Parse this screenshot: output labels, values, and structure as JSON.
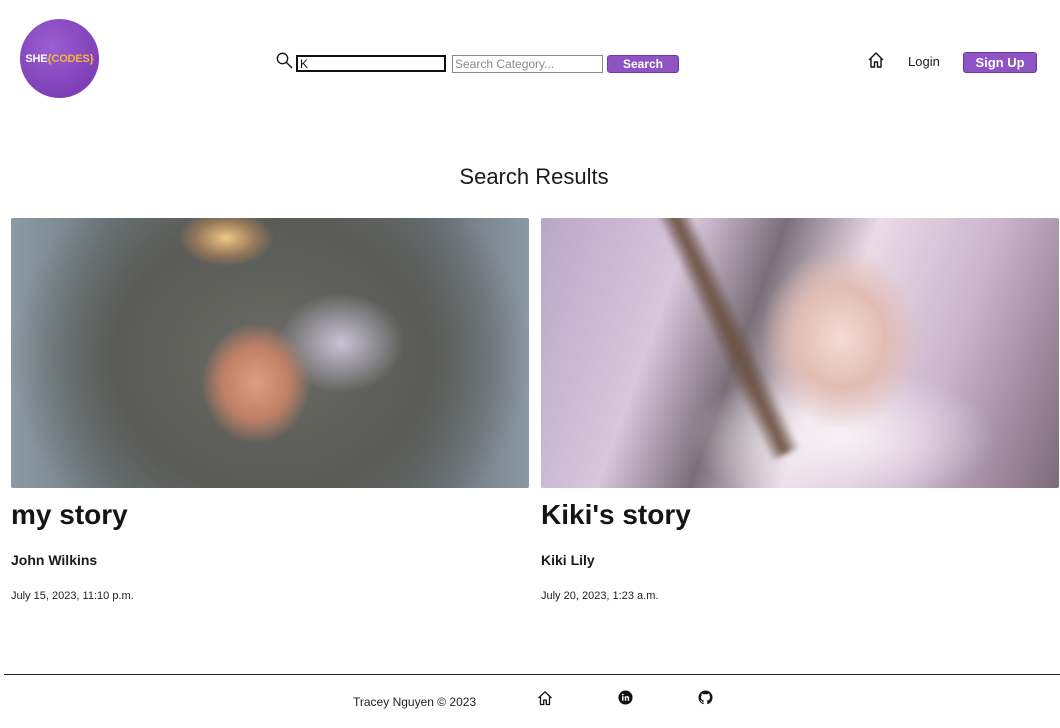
{
  "header": {
    "logo": {
      "she": "SHE",
      "codes": "{CODES}"
    },
    "search": {
      "value": "K",
      "category_placeholder": "Search Category...",
      "button_label": "Search"
    },
    "nav": {
      "login_label": "Login",
      "signup_label": "Sign Up"
    }
  },
  "main": {
    "title": "Search Results",
    "stories": [
      {
        "title": "my story",
        "author": "John Wilkins",
        "date": "July 15, 2023, 11:10 p.m."
      },
      {
        "title": "Kiki's story",
        "author": "Kiki Lily",
        "date": "July 20, 2023, 1:23 a.m."
      }
    ]
  },
  "footer": {
    "credit": "Tracey Nguyen © 2023"
  },
  "colors": {
    "accent": "#8e54c4",
    "logo_bg": "#7f3fb8",
    "logo_codes": "#f4b63f"
  },
  "icons": {
    "search": "search-icon",
    "home": "home-icon",
    "linkedin": "linkedin-icon",
    "github": "github-icon"
  }
}
